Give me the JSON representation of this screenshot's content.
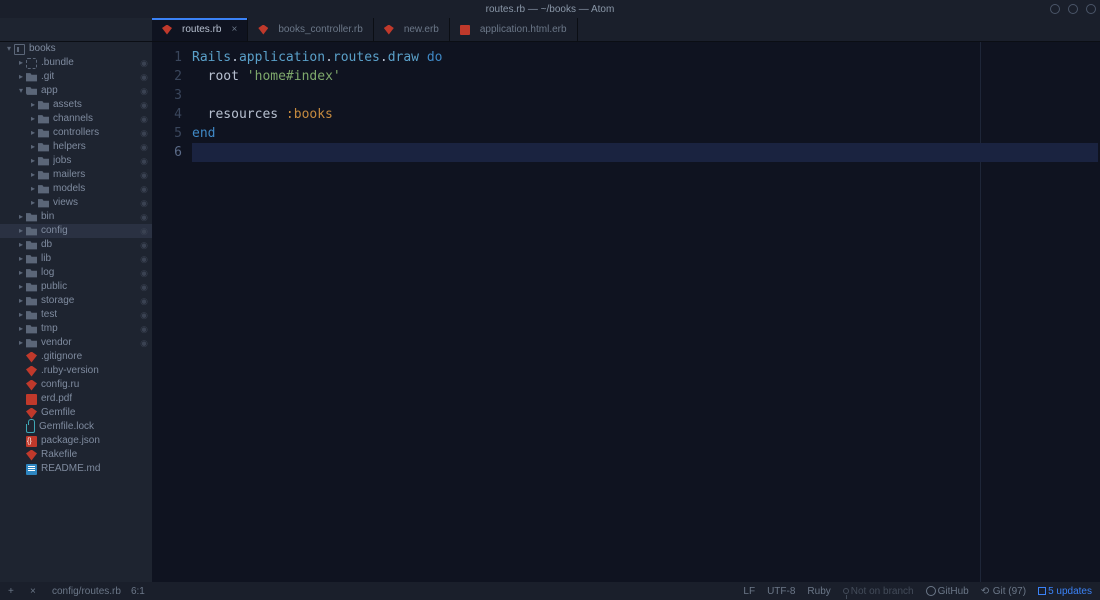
{
  "window": {
    "title": "routes.rb — ~/books — Atom"
  },
  "tabs": [
    {
      "label": "routes.rb",
      "icon": "ruby",
      "active": true,
      "closeable": true
    },
    {
      "label": "books_controller.rb",
      "icon": "ruby",
      "active": false
    },
    {
      "label": "new.erb",
      "icon": "ruby",
      "active": false
    },
    {
      "label": "application.html.erb",
      "icon": "pdf",
      "active": false
    }
  ],
  "tree": {
    "root": "books",
    "items": [
      {
        "depth": 0,
        "arrow": "down",
        "icon": "repo",
        "name": "books"
      },
      {
        "depth": 1,
        "arrow": "right",
        "icon": "bundle",
        "name": ".bundle",
        "eye": true
      },
      {
        "depth": 1,
        "arrow": "right",
        "icon": "folder",
        "name": ".git",
        "eye": true
      },
      {
        "depth": 1,
        "arrow": "down",
        "icon": "folder open",
        "name": "app",
        "eye": true
      },
      {
        "depth": 2,
        "arrow": "right",
        "icon": "folder",
        "name": "assets",
        "eye": true
      },
      {
        "depth": 2,
        "arrow": "right",
        "icon": "folder",
        "name": "channels",
        "eye": true
      },
      {
        "depth": 2,
        "arrow": "right",
        "icon": "folder",
        "name": "controllers",
        "eye": true
      },
      {
        "depth": 2,
        "arrow": "right",
        "icon": "folder",
        "name": "helpers",
        "eye": true
      },
      {
        "depth": 2,
        "arrow": "right",
        "icon": "folder",
        "name": "jobs",
        "eye": true
      },
      {
        "depth": 2,
        "arrow": "right",
        "icon": "folder",
        "name": "mailers",
        "eye": true
      },
      {
        "depth": 2,
        "arrow": "right",
        "icon": "folder",
        "name": "models",
        "eye": true
      },
      {
        "depth": 2,
        "arrow": "right",
        "icon": "folder",
        "name": "views",
        "eye": true
      },
      {
        "depth": 1,
        "arrow": "right",
        "icon": "folder",
        "name": "bin",
        "eye": true
      },
      {
        "depth": 1,
        "arrow": "right",
        "icon": "folder",
        "name": "config",
        "eye": true,
        "selected": true
      },
      {
        "depth": 1,
        "arrow": "right",
        "icon": "folder",
        "name": "db",
        "eye": true
      },
      {
        "depth": 1,
        "arrow": "right",
        "icon": "folder",
        "name": "lib",
        "eye": true
      },
      {
        "depth": 1,
        "arrow": "right",
        "icon": "folder",
        "name": "log",
        "eye": true
      },
      {
        "depth": 1,
        "arrow": "right",
        "icon": "folder",
        "name": "public",
        "eye": true
      },
      {
        "depth": 1,
        "arrow": "right",
        "icon": "folder",
        "name": "storage",
        "eye": true
      },
      {
        "depth": 1,
        "arrow": "right",
        "icon": "folder",
        "name": "test",
        "eye": true
      },
      {
        "depth": 1,
        "arrow": "right",
        "icon": "folder",
        "name": "tmp",
        "eye": true
      },
      {
        "depth": 1,
        "arrow": "right",
        "icon": "folder",
        "name": "vendor",
        "eye": true
      },
      {
        "depth": 1,
        "arrow": "",
        "icon": "ruby",
        "name": ".gitignore"
      },
      {
        "depth": 1,
        "arrow": "",
        "icon": "ruby",
        "name": ".ruby-version"
      },
      {
        "depth": 1,
        "arrow": "",
        "icon": "ruby",
        "name": "config.ru"
      },
      {
        "depth": 1,
        "arrow": "",
        "icon": "pdf",
        "name": "erd.pdf"
      },
      {
        "depth": 1,
        "arrow": "",
        "icon": "ruby",
        "name": "Gemfile"
      },
      {
        "depth": 1,
        "arrow": "",
        "icon": "lock",
        "name": "Gemfile.lock"
      },
      {
        "depth": 1,
        "arrow": "",
        "icon": "json",
        "name": "package.json"
      },
      {
        "depth": 1,
        "arrow": "",
        "icon": "ruby",
        "name": "Rakefile"
      },
      {
        "depth": 1,
        "arrow": "",
        "icon": "md",
        "name": "README.md"
      }
    ]
  },
  "editor": {
    "lines": [
      [
        {
          "t": "Rails",
          "c": "k-const"
        },
        {
          "t": ".",
          "c": "k-id"
        },
        {
          "t": "application",
          "c": "k-method"
        },
        {
          "t": ".",
          "c": "k-id"
        },
        {
          "t": "routes",
          "c": "k-method"
        },
        {
          "t": ".",
          "c": "k-id"
        },
        {
          "t": "draw",
          "c": "k-method"
        },
        {
          "t": " ",
          "c": ""
        },
        {
          "t": "do",
          "c": "k-do"
        }
      ],
      [
        {
          "t": "  root ",
          "c": "k-id"
        },
        {
          "t": "'home#index'",
          "c": "k-str"
        }
      ],
      [],
      [
        {
          "t": "  resources ",
          "c": "k-id"
        },
        {
          "t": ":books",
          "c": "k-sym"
        }
      ],
      [
        {
          "t": "end",
          "c": "k-kw"
        }
      ],
      []
    ],
    "current_line": 6
  },
  "status": {
    "path": "config/routes.rb",
    "cursor": "6:1",
    "line_ending": "LF",
    "encoding": "UTF-8",
    "grammar": "Ruby",
    "branch_label": "Not on branch",
    "github": "GitHub",
    "git_count": "Git (97)",
    "updates": "5 updates"
  }
}
